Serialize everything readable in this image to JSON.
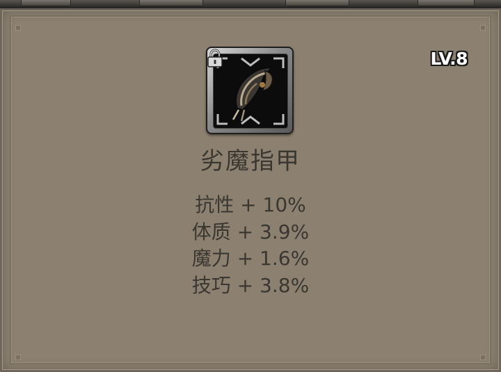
{
  "item": {
    "name": "劣魔指甲",
    "level": "LV.8",
    "icon": "demon-claw-icon",
    "locked": true
  },
  "stats": [
    {
      "text": "抗性 + 10%"
    },
    {
      "text": "体质 + 3.9%"
    },
    {
      "text": "魔力 + 1.6%"
    },
    {
      "text": "技巧 + 3.8%"
    }
  ],
  "colors": {
    "panel": "#8c8170",
    "text": "#3a3630",
    "level_text": "#ffffff",
    "level_outline": "#1a1a1a"
  }
}
